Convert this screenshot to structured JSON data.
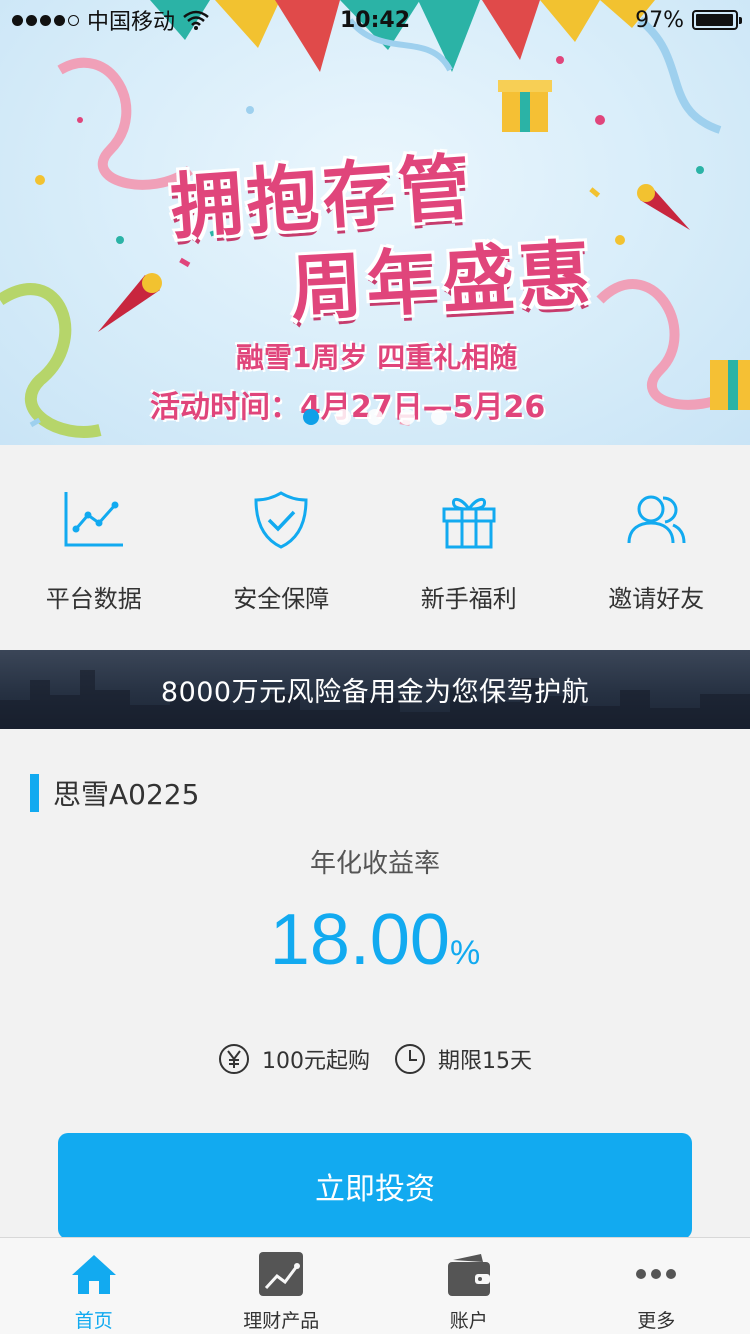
{
  "status_bar": {
    "carrier": "中国移动",
    "time": "10:42",
    "battery": "97%",
    "battery_level": 0.97
  },
  "banner": {
    "title_line1": "拥抱存管",
    "title_line2": "周年盛惠",
    "subtitle": "融雪1周岁 四重礼相随",
    "date_text": "活动时间：4月27日—5月26",
    "slide_count": 5,
    "active_slide": 0
  },
  "quick_entries": [
    {
      "label": "平台数据",
      "icon": "chart-icon"
    },
    {
      "label": "安全保障",
      "icon": "shield-icon"
    },
    {
      "label": "新手福利",
      "icon": "gift-icon"
    },
    {
      "label": "邀请好友",
      "icon": "friends-icon"
    }
  ],
  "notice": {
    "text": "8000万元风险备用金为您保驾护航"
  },
  "product": {
    "name": "思雪A0225",
    "rate_label": "年化收益率",
    "rate_value": "18.00",
    "rate_unit": "%",
    "min_purchase": "100元起购",
    "term": "期限15天",
    "invest_label": "立即投资"
  },
  "tabbar": [
    {
      "label": "首页",
      "icon": "home-icon",
      "active": true
    },
    {
      "label": "理财产品",
      "icon": "trend-icon",
      "active": false
    },
    {
      "label": "账户",
      "icon": "wallet-icon",
      "active": false
    },
    {
      "label": "更多",
      "icon": "more-icon",
      "active": false
    }
  ],
  "colors": {
    "accent": "#12aaf0",
    "banner_text": "#e0457b",
    "tab_inactive": "#555555"
  }
}
